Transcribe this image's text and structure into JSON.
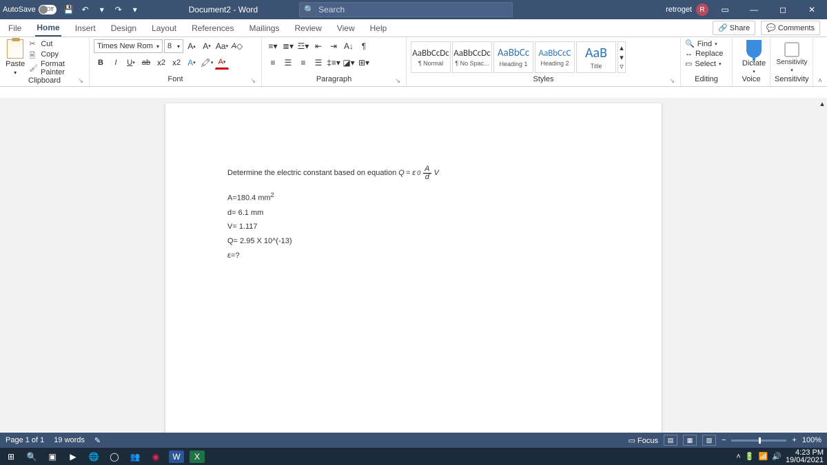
{
  "title": {
    "autosave": "AutoSave",
    "off": "Off",
    "doc": "Document2 - Word",
    "search": "Search",
    "user": "retroget",
    "avatar": "R"
  },
  "tabs": [
    "File",
    "Home",
    "Insert",
    "Design",
    "Layout",
    "References",
    "Mailings",
    "Review",
    "View",
    "Help"
  ],
  "share": "Share",
  "comments": "Comments",
  "clipboard": {
    "paste": "Paste",
    "cut": "Cut",
    "copy": "Copy",
    "fp": "Format Painter",
    "label": "Clipboard"
  },
  "font": {
    "name": "Times New Rom",
    "size": "8",
    "label": "Font"
  },
  "paragraph": {
    "label": "Paragraph"
  },
  "styles": {
    "label": "Styles",
    "items": [
      {
        "prev": "AaBbCcDc",
        "name": "¶ Normal"
      },
      {
        "prev": "AaBbCcDc",
        "name": "¶ No Spac..."
      },
      {
        "prev": "AaBbCc",
        "name": "Heading 1"
      },
      {
        "prev": "AaBbCcC",
        "name": "Heading 2"
      },
      {
        "prev": "AaB",
        "name": "Title"
      }
    ]
  },
  "editing": {
    "find": "Find",
    "replace": "Replace",
    "select": "Select",
    "label": "Editing"
  },
  "voice": {
    "dictate": "Dictate",
    "label": "Voice"
  },
  "sensitivity": {
    "btn": "Sensitivity",
    "label": "Sensitivity"
  },
  "doc": {
    "l1a": "Determine the electric constant based on equation ",
    "l1q": "Q",
    " l1eq": " = ε",
    "l1sub": "0",
    "l1A": "A",
    "l1d": "d",
    "l1V": "V",
    "l2": "A=180.4 mm",
    "l2sup": "2",
    "l3": "d= 6.1 mm",
    "l4": "V= 1.117",
    "l5": "Q= 2.95 X 10^(-13)",
    "l6": "ε=?"
  },
  "status": {
    "page": "Page 1 of 1",
    "words": "19 words",
    "focus": "Focus",
    "zoom": "100%"
  },
  "tray": {
    "time": "4:23 PM",
    "date": "19/04/2021"
  }
}
